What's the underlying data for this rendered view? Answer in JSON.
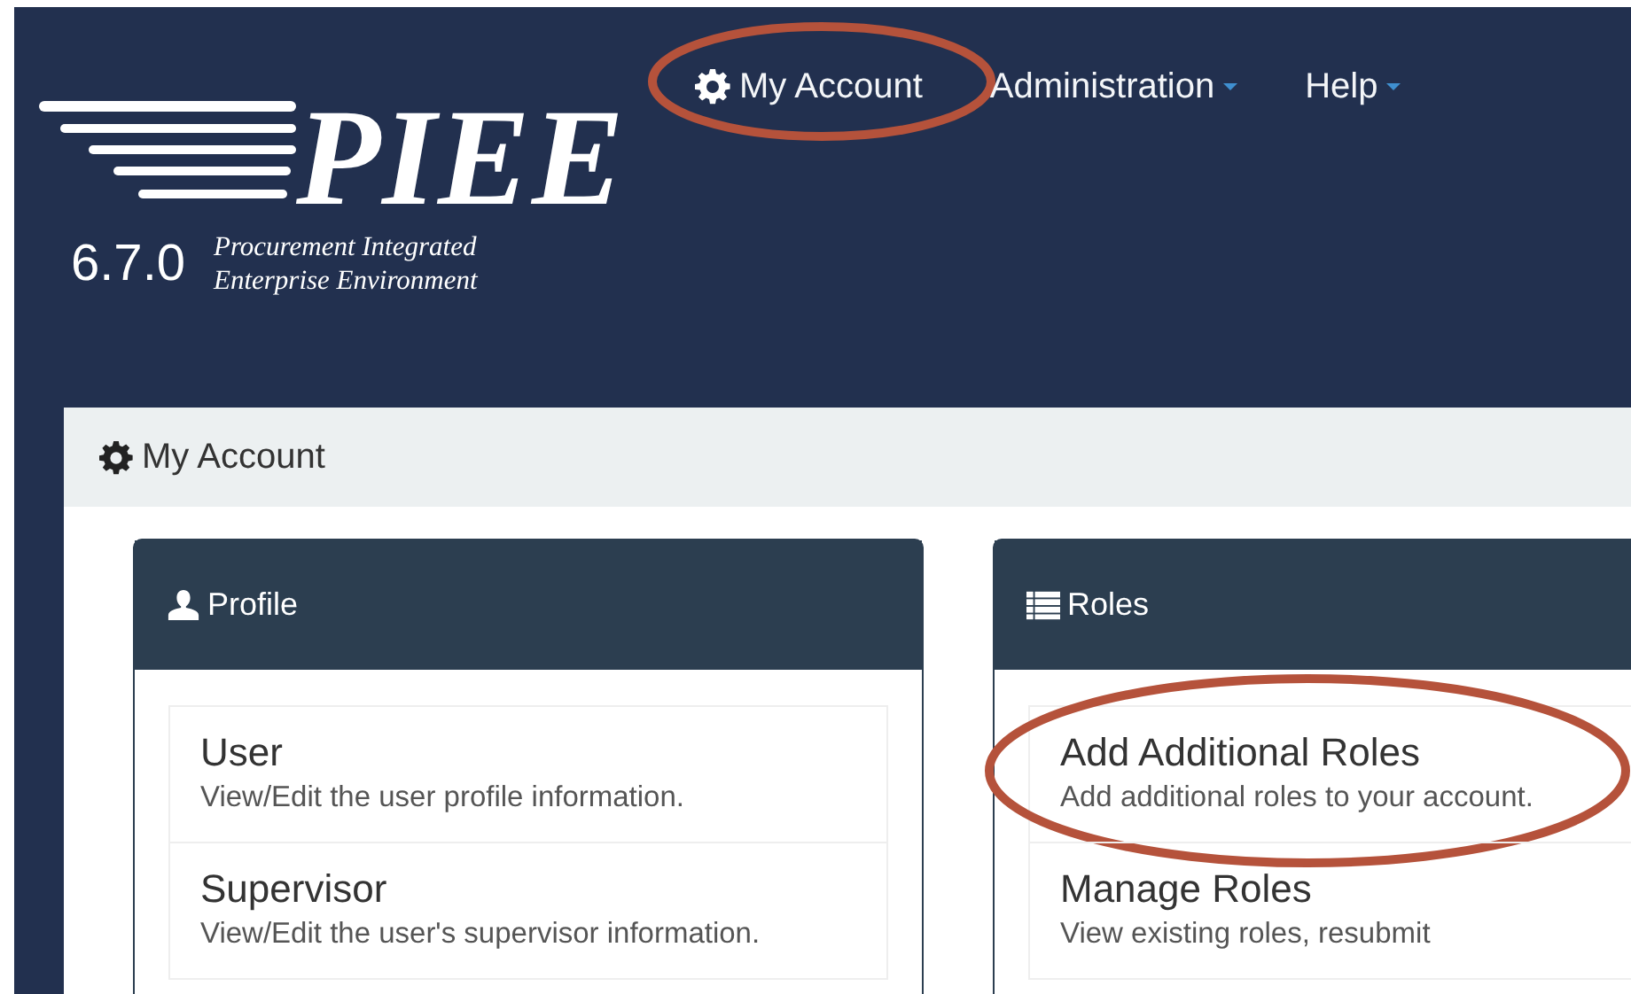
{
  "logo": {
    "wordmark": "PIEE",
    "version": "6.7.0",
    "tagline": [
      "Procurement Integrated",
      "Enterprise Environment"
    ]
  },
  "nav": [
    {
      "label": "My Account",
      "kind": "link",
      "highlighted": true
    },
    {
      "label": "Administration",
      "kind": "menu",
      "highlighted": false
    },
    {
      "label": "Help",
      "kind": "menu",
      "highlighted": false
    }
  ],
  "panel": {
    "title": "My Account",
    "cards": [
      {
        "title": "Profile",
        "items": [
          {
            "title": "User",
            "description": "View/Edit the user profile information.",
            "highlighted": false
          },
          {
            "title": "Supervisor",
            "description": "View/Edit the user's supervisor information.",
            "highlighted": false
          }
        ]
      },
      {
        "title": "Roles",
        "items": [
          {
            "title": "Add Additional Roles",
            "description": "Add additional roles to your account.",
            "highlighted": true
          },
          {
            "title": "Manage Roles",
            "description": "View existing roles, resubmit",
            "highlighted": false
          }
        ]
      }
    ]
  }
}
